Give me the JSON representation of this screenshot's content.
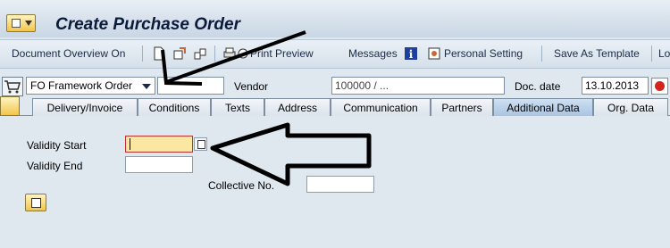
{
  "window": {
    "title": "Create Purchase Order"
  },
  "toolbar": {
    "document_overview": "Document Overview On",
    "print_preview": "Print Preview",
    "messages": "Messages",
    "personal_setting": "Personal Setting",
    "save_as_template": "Save As Template",
    "load_truncated": "Lo"
  },
  "header": {
    "order_type": "FO Framework Order",
    "doc_number": "",
    "vendor_label": "Vendor",
    "vendor_value": "100000 / ...",
    "doc_date_label": "Doc. date",
    "doc_date_value": "13.10.2013"
  },
  "tabs": [
    {
      "label": "Delivery/Invoice",
      "active": false
    },
    {
      "label": "Conditions",
      "active": false
    },
    {
      "label": "Texts",
      "active": false
    },
    {
      "label": "Address",
      "active": false
    },
    {
      "label": "Communication",
      "active": false
    },
    {
      "label": "Partners",
      "active": false
    },
    {
      "label": "Additional Data",
      "active": true
    },
    {
      "label": "Org. Data",
      "active": false
    }
  ],
  "form": {
    "validity_start_label": "Validity Start",
    "validity_start_value": "",
    "validity_end_label": "Validity End",
    "validity_end_value": "",
    "collective_no_label": "Collective No.",
    "collective_no_value": ""
  },
  "colors": {
    "focus_field": "#fbe7a1",
    "active_tab": "#a9c4e2",
    "status_red": "#d8231c",
    "arrow": "#000000"
  }
}
